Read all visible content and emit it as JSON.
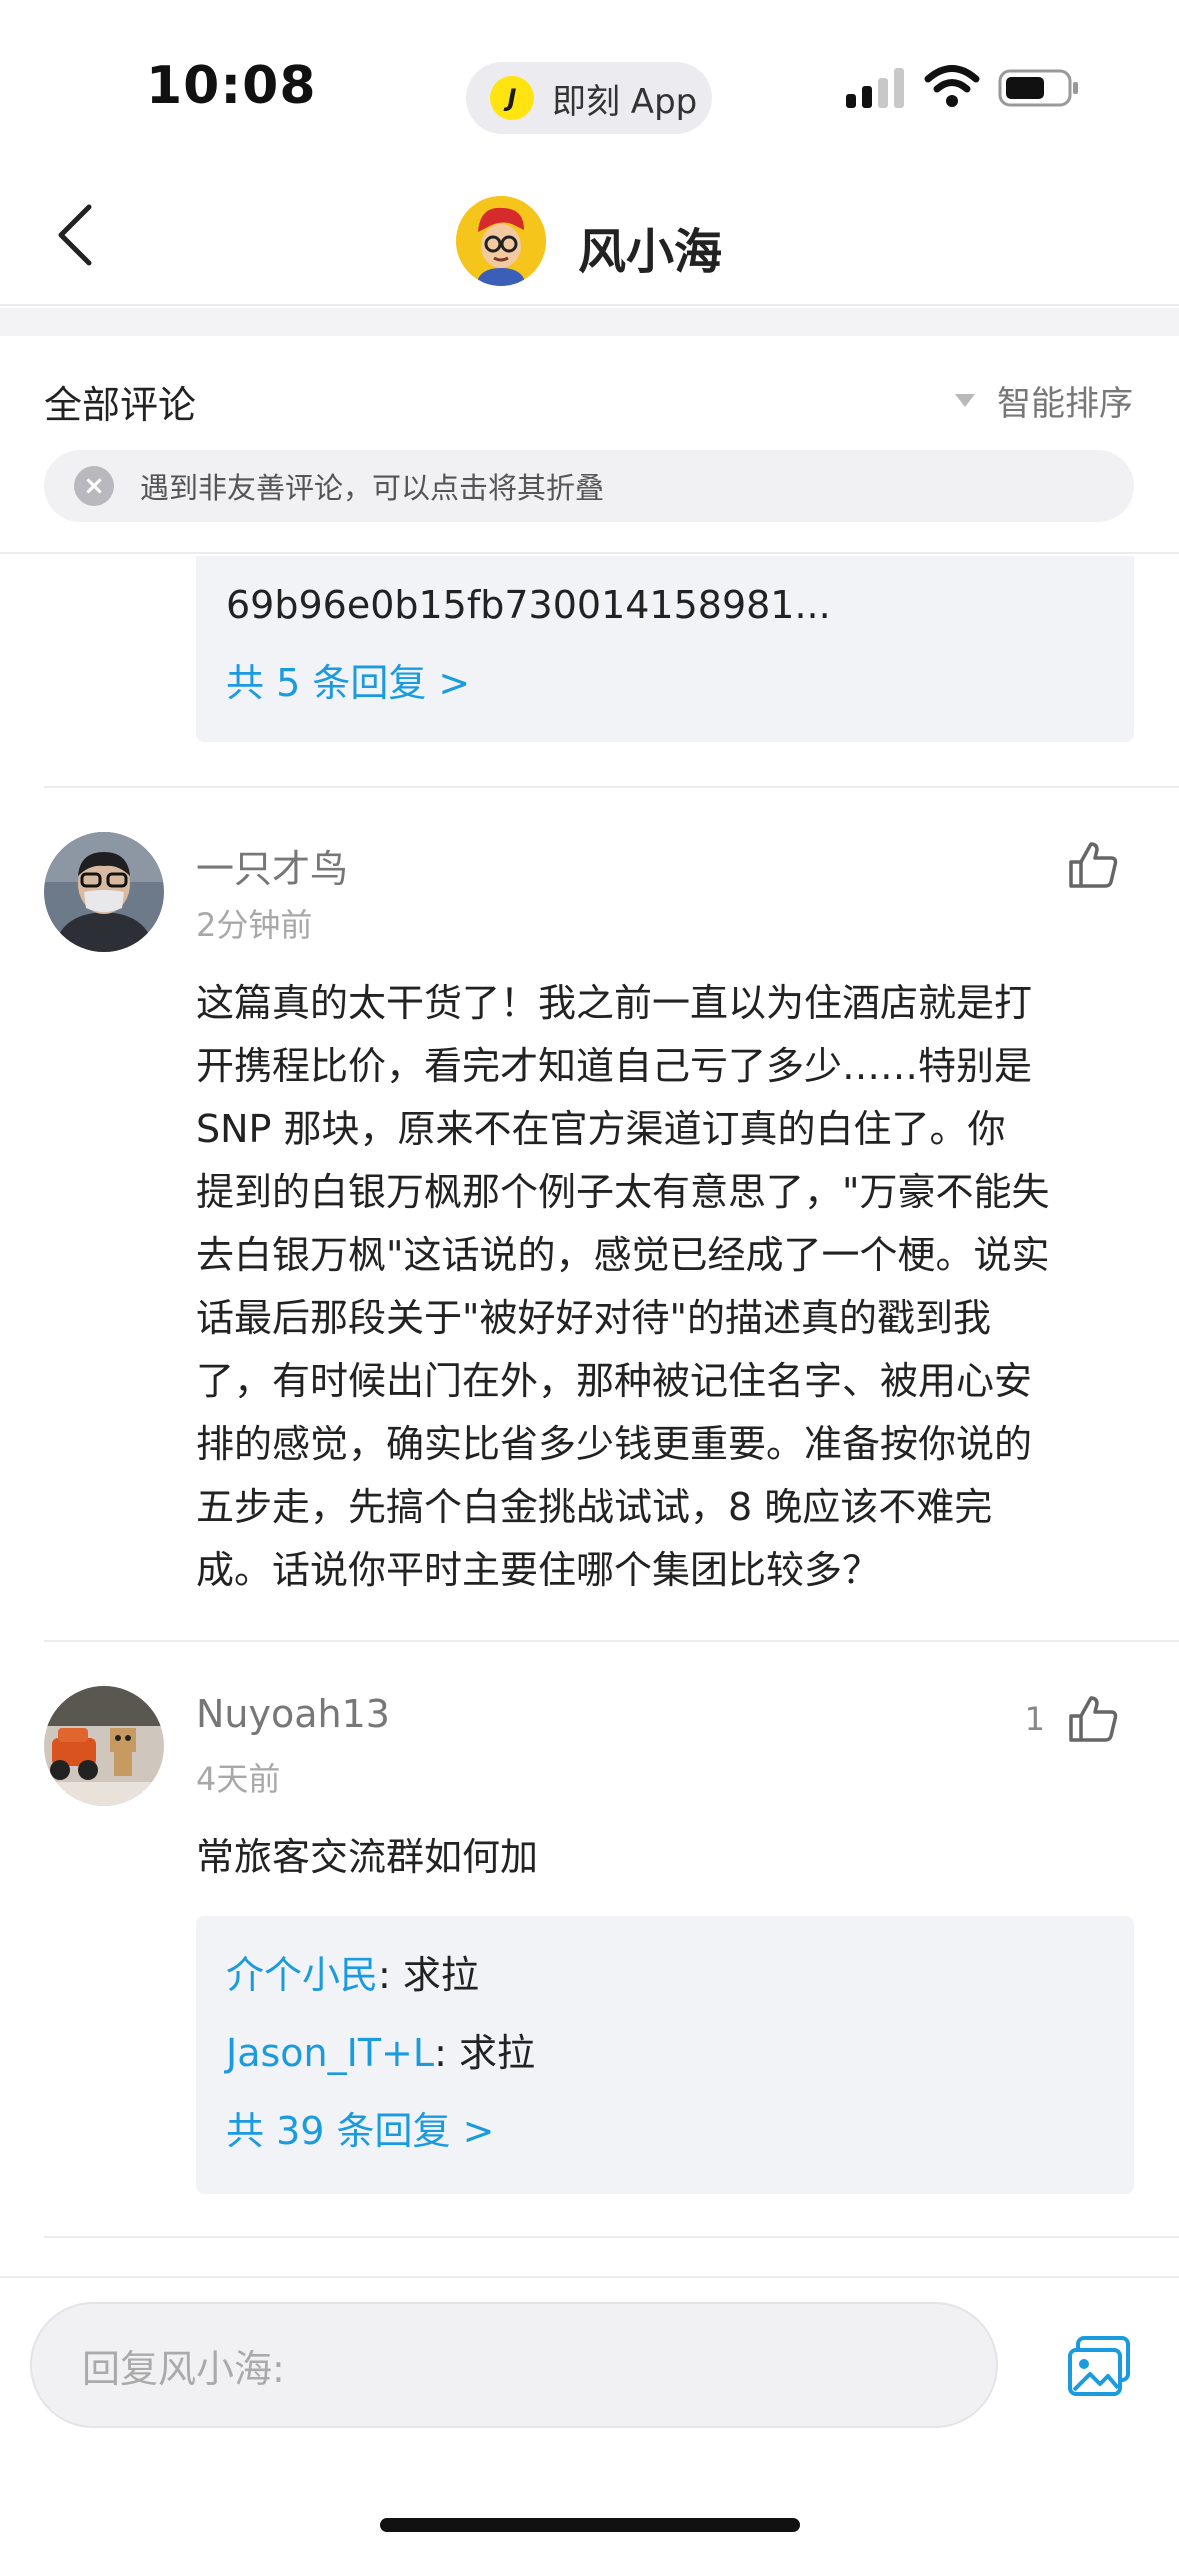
{
  "status_bar": {
    "time": "10:08",
    "app_pill_logo": "J",
    "app_pill_label": "即刻 App"
  },
  "nav": {
    "title": "风小海",
    "back_icon": "chevron-left-icon"
  },
  "comments_header": {
    "all_comments_label": "全部评论",
    "sort_label": "智能排序",
    "notice": "遇到非友善评论，可以点击将其折叠"
  },
  "partial_reply": {
    "text": "69b96e0b15fb730014158981...",
    "more": "共 5 条回复 >"
  },
  "comments": [
    {
      "username": "一只才鸟",
      "time": "2分钟前",
      "likes": "",
      "lines": [
        "这篇真的太干货了！我之前一直以为住酒店就是打",
        "开携程比价，看完才知道自己亏了多少……特别是",
        "SNP 那块，原来不在官方渠道订真的白住了。你",
        "提到的白银万枫那个例子太有意思了，\"万豪不能失",
        "去白银万枫\"这话说的，感觉已经成了一个梗。说实",
        "话最后那段关于\"被好好对待\"的描述真的戳到我",
        "了，有时候出门在外，那种被记住名字、被用心安",
        "排的感觉，确实比省多少钱更重要。准备按你说的",
        "五步走，先搞个白金挑战试试，8 晚应该不难完",
        "成。话说你平时主要住哪个集团比较多？"
      ]
    },
    {
      "username": "Nuyoah13",
      "time": "4天前",
      "likes": "1",
      "lines": [
        "常旅客交流群如何加"
      ],
      "replies": [
        {
          "user": "介个小民",
          "text": ": 求拉"
        },
        {
          "user": "Jason_IT+L",
          "text": ": 求拉"
        }
      ],
      "more": "共 39 条回复 >"
    }
  ],
  "bottom": {
    "placeholder": "回复风小海:"
  },
  "colors": {
    "accent": "#1a9be0",
    "pill_bg": "#ececf0",
    "reply_bg": "#f2f3f6"
  }
}
